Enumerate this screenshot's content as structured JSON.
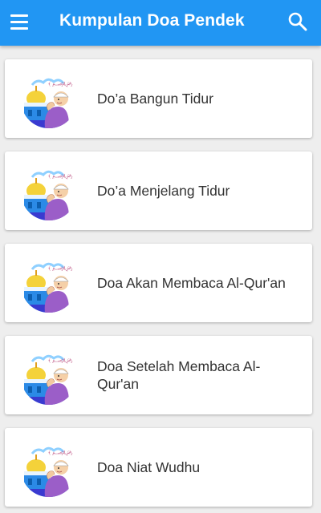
{
  "appbar": {
    "title": "Kumpulan Doa Pendek",
    "background": "#2196f3",
    "menu_icon": "hamburger-menu-icon",
    "search_icon": "search-icon"
  },
  "items": [
    {
      "label": "Do’a Bangun Tidur",
      "image": "praying-boy-mosque-illustration"
    },
    {
      "label": "Do’a Menjelang Tidur",
      "image": "praying-boy-mosque-illustration"
    },
    {
      "label": "Doa Akan Membaca Al-Qur'an",
      "image": "praying-boy-mosque-illustration"
    },
    {
      "label": "Doa Setelah Membaca Al-Qur'an",
      "image": "praying-boy-mosque-illustration"
    },
    {
      "label": "Doa Niat Wudhu",
      "image": "praying-boy-mosque-illustration"
    }
  ]
}
